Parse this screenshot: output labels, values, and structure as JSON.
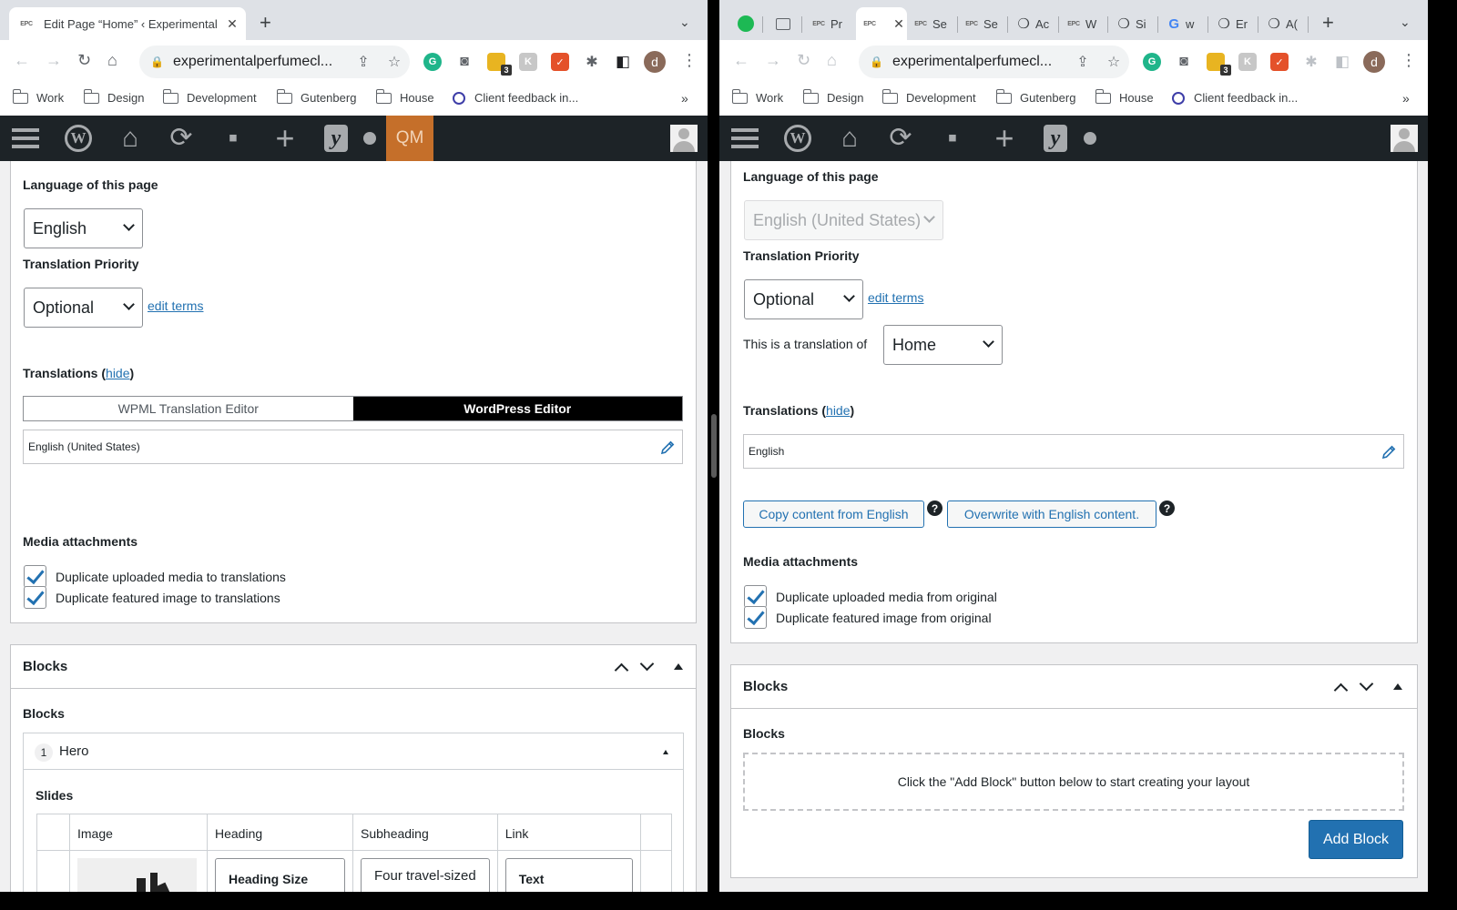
{
  "left": {
    "tab": {
      "favicon": "EPC",
      "title": "Edit Page “Home” ‹ Experimental",
      "close": "✕"
    },
    "url": "experimentalperfumecl...",
    "bookmarks": [
      "Work",
      "Design",
      "Development",
      "Gutenberg",
      "House",
      "Client feedback in..."
    ],
    "bookmarks_more": "»",
    "ext_badge": "3",
    "profile_initial": "d",
    "adminbar": {
      "qm": "QM"
    },
    "language": {
      "label": "Language of this page",
      "value": "English"
    },
    "priority": {
      "label": "Translation Priority",
      "value": "Optional",
      "edit": "edit terms"
    },
    "translations": {
      "label": "Translations (",
      "hide": "hide",
      "close": ")",
      "editor_a": "WPML Translation Editor",
      "editor_b": "WordPress Editor",
      "row": "English (United States)"
    },
    "media": {
      "label": "Media attachments",
      "opt1": "Duplicate uploaded media to translations",
      "opt2": "Duplicate featured image to translations"
    },
    "blocks": {
      "title": "Blocks",
      "label": "Blocks",
      "layout_num": "1",
      "layout_name": "Hero",
      "slides_label": "Slides",
      "columns": [
        "Image",
        "Heading",
        "Subheading",
        "Link"
      ],
      "row": {
        "heading": "Heading Size",
        "subheading": "Four travel-sized",
        "link": "Text"
      }
    }
  },
  "right": {
    "tabs": [
      {
        "favicon": "",
        "title": ""
      },
      {
        "favicon": "",
        "title": ""
      },
      {
        "favicon": "EPC",
        "title": "Pr"
      },
      {
        "favicon": "EPC",
        "title": ""
      },
      {
        "favicon": "EPC",
        "title": "Se"
      },
      {
        "favicon": "EPC",
        "title": "Se"
      },
      {
        "favicon": "",
        "title": "Ac"
      },
      {
        "favicon": "EPC",
        "title": "W"
      },
      {
        "favicon": "",
        "title": "Si"
      },
      {
        "favicon": "G",
        "title": "w"
      },
      {
        "favicon": "",
        "title": "Er"
      },
      {
        "favicon": "",
        "title": "A("
      }
    ],
    "active_close": "✕",
    "url": "experimentalperfumecl...",
    "bookmarks": [
      "Work",
      "Design",
      "Development",
      "Gutenberg",
      "House",
      "Client feedback in..."
    ],
    "bookmarks_more": "»",
    "ext_badge": "3",
    "profile_initial": "d",
    "language": {
      "label": "Language of this page",
      "value": "English (United States)"
    },
    "priority": {
      "label": "Translation Priority",
      "value": "Optional",
      "edit": "edit terms"
    },
    "translation_of": {
      "label": "This is a translation of",
      "value": "Home"
    },
    "translations": {
      "label": "Translations (",
      "hide": "hide",
      "close": ")",
      "row": "English"
    },
    "copy_button": "Copy content from English",
    "overwrite_button": "Overwrite with English content.",
    "help": "?",
    "media": {
      "label": "Media attachments",
      "opt1": "Duplicate uploaded media from original",
      "opt2": "Duplicate featured image from original"
    },
    "blocks": {
      "title": "Blocks",
      "label": "Blocks",
      "empty": "Click the \"Add Block\" button below to start creating your layout",
      "add_button": "Add Block"
    }
  },
  "colors": {
    "wp_blue": "#2271b1",
    "admin_bar": "#1d2327",
    "qm_orange": "#c56f2a"
  }
}
